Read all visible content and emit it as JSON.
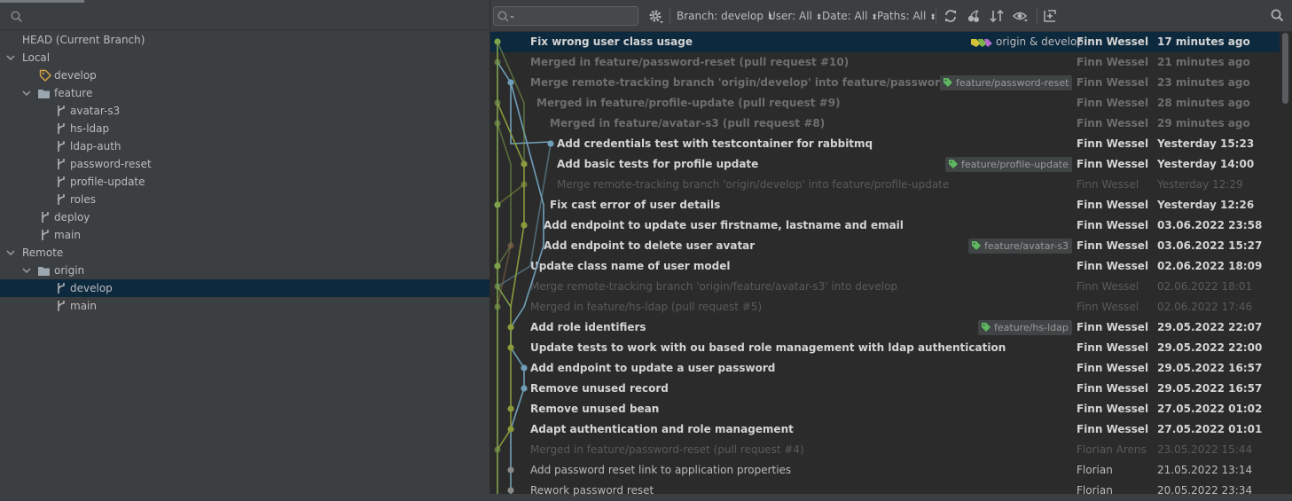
{
  "left_panel": {
    "tree": [
      {
        "label": "HEAD (Current Branch)",
        "kind": "head",
        "depth": 0
      },
      {
        "label": "Local",
        "kind": "group",
        "depth": 0,
        "expanded": true
      },
      {
        "label": "develop",
        "kind": "tag",
        "depth": 2
      },
      {
        "label": "feature",
        "kind": "folder",
        "depth": 1,
        "expanded": true
      },
      {
        "label": "avatar-s3",
        "kind": "branch",
        "depth": 3
      },
      {
        "label": "hs-ldap",
        "kind": "branch",
        "depth": 3
      },
      {
        "label": "ldap-auth",
        "kind": "branch",
        "depth": 3
      },
      {
        "label": "password-reset",
        "kind": "branch",
        "depth": 3
      },
      {
        "label": "profile-update",
        "kind": "branch",
        "depth": 3
      },
      {
        "label": "roles",
        "kind": "branch",
        "depth": 3
      },
      {
        "label": "deploy",
        "kind": "branch",
        "depth": 2
      },
      {
        "label": "main",
        "kind": "branch",
        "depth": 2
      },
      {
        "label": "Remote",
        "kind": "group",
        "depth": 0,
        "expanded": true
      },
      {
        "label": "origin",
        "kind": "folder",
        "depth": 1,
        "expanded": true
      },
      {
        "label": "develop",
        "kind": "branch",
        "depth": 3,
        "selected": true
      },
      {
        "label": "main",
        "kind": "branch",
        "depth": 3
      }
    ]
  },
  "toolbar": {
    "branch_filter": "Branch: develop",
    "user_filter": "User: All",
    "date_filter": "Date: All",
    "paths_filter": "Paths: All"
  },
  "commits": [
    {
      "message": "Fix wrong user class usage",
      "author": "Finn Wessel",
      "date": "17 minutes ago",
      "style": "bold",
      "selected": true,
      "ref_label": "origin & develop"
    },
    {
      "message": "Merged in feature/password-reset (pull request #10)",
      "author": "Finn Wessel",
      "date": "21 minutes ago",
      "style": "dim"
    },
    {
      "message": "Merge remote-tracking branch 'origin/develop' into feature/password-reset",
      "author": "Finn Wessel",
      "date": "23 minutes ago",
      "style": "dim",
      "tag": "feature/password-reset"
    },
    {
      "message": "Merged in feature/profile-update (pull request #9)",
      "author": "Finn Wessel",
      "date": "28 minutes ago",
      "style": "dim"
    },
    {
      "message": "Merged in feature/avatar-s3 (pull request #8)",
      "author": "Finn Wessel",
      "date": "29 minutes ago",
      "style": "dim"
    },
    {
      "message": "Add credentials test with testcontainer for rabbitmq",
      "author": "Finn Wessel",
      "date": "Yesterday 15:23",
      "style": "bold"
    },
    {
      "message": "Add basic tests for profile update",
      "author": "Finn Wessel",
      "date": "Yesterday 14:00",
      "style": "bold",
      "tag": "feature/profile-update"
    },
    {
      "message": "Merge remote-tracking branch 'origin/develop' into feature/profile-update",
      "author": "Finn Wessel",
      "date": "Yesterday 12:29",
      "style": "faint"
    },
    {
      "message": "Fix cast error of user details",
      "author": "Finn Wessel",
      "date": "Yesterday 12:26",
      "style": "bold"
    },
    {
      "message": "Add endpoint to update user firstname, lastname and email",
      "author": "Finn Wessel",
      "date": "03.06.2022 23:58",
      "style": "bold"
    },
    {
      "message": "Add endpoint to delete user avatar",
      "author": "Finn Wessel",
      "date": "03.06.2022 15:27",
      "style": "bold",
      "tag": "feature/avatar-s3"
    },
    {
      "message": "Update class name of user model",
      "author": "Finn Wessel",
      "date": "02.06.2022 18:09",
      "style": "bold"
    },
    {
      "message": "Merge remote-tracking branch 'origin/feature/avatar-s3' into develop",
      "author": "Finn Wessel",
      "date": "02.06.2022 18:01",
      "style": "faint"
    },
    {
      "message": "Merged in feature/hs-ldap (pull request #5)",
      "author": "Finn Wessel",
      "date": "02.06.2022 17:46",
      "style": "faint"
    },
    {
      "message": "Add role identifiers",
      "author": "Finn Wessel",
      "date": "29.05.2022 22:07",
      "style": "bold",
      "tag": "feature/hs-ldap"
    },
    {
      "message": "Update tests to work with ou based role management with ldap authentication",
      "author": "Finn Wessel",
      "date": "29.05.2022 22:00",
      "style": "bold"
    },
    {
      "message": "Add endpoint to update a user password",
      "author": "Finn Wessel",
      "date": "29.05.2022 16:57",
      "style": "bold"
    },
    {
      "message": "Remove unused record",
      "author": "Finn Wessel",
      "date": "29.05.2022 16:57",
      "style": "bold"
    },
    {
      "message": "Remove unused bean",
      "author": "Finn Wessel",
      "date": "27.05.2022 01:02",
      "style": "bold"
    },
    {
      "message": "Adapt authentication and role management",
      "author": "Finn Wessel",
      "date": "27.05.2022 01:01",
      "style": "bold"
    },
    {
      "message": "Merged in feature/password-reset (pull request #4)",
      "author": "Florian Arens",
      "date": "23.05.2022 15:44",
      "style": "faint"
    },
    {
      "message": "Add password reset link to application properties",
      "author": "Florian",
      "date": "21.05.2022 13:14",
      "style": "plain"
    },
    {
      "message": "Rework password reset",
      "author": "Florian",
      "date": "20.05.2022 23:34",
      "style": "plain"
    }
  ],
  "colors": {
    "selection": "#0d293e",
    "lane_green": "#7fa24c",
    "lane_blue": "#6f9fb8",
    "lane_olive": "#8a9a3c",
    "tag_green": "#5fb85f"
  }
}
